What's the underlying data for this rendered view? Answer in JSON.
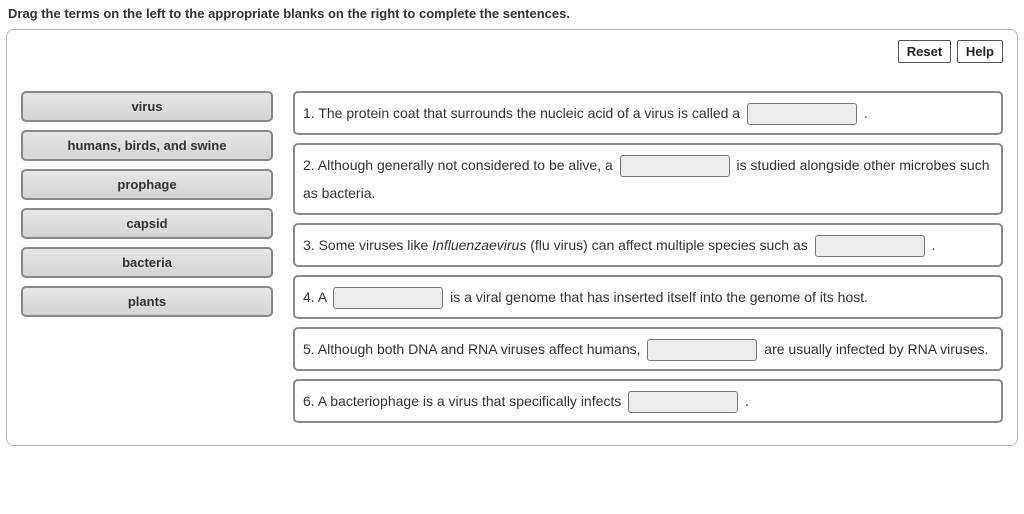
{
  "instruction": "Drag the terms on the left to the appropriate blanks on the right to complete the sentences.",
  "buttons": {
    "reset": "Reset",
    "help": "Help"
  },
  "terms": [
    "virus",
    "humans, birds, and swine",
    "prophage",
    "capsid",
    "bacteria",
    "plants"
  ],
  "sentences": {
    "s1a": "1. The protein coat that surrounds the nucleic acid of a virus is called a ",
    "s1b": " .",
    "s2a": "2. Although generally not considered to be alive, a ",
    "s2b": " is studied alongside other microbes such as bacteria.",
    "s3a": "3. Some viruses like ",
    "s3italic": "Influenzaevirus",
    "s3b": " (flu virus) can affect multiple species such as ",
    "s3c": " .",
    "s4a": "4. A ",
    "s4b": " is a viral genome that has inserted itself into the genome of its host.",
    "s5a": "5. Although both DNA and RNA viruses affect humans, ",
    "s5b": " are usually infected by RNA viruses.",
    "s6a": "6. A bacteriophage is a virus that specifically infects ",
    "s6b": " ."
  }
}
